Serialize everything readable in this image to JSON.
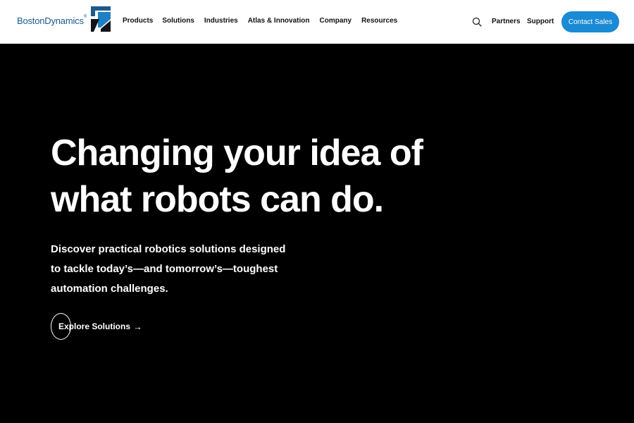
{
  "header": {
    "logo_text": "BostonDynamics",
    "logo_reg": "®",
    "nav": [
      {
        "label": "Products"
      },
      {
        "label": "Solutions"
      },
      {
        "label": "Industries"
      },
      {
        "label": "Atlas & Innovation"
      },
      {
        "label": "Company"
      },
      {
        "label": "Resources"
      }
    ],
    "search_icon": "search-icon",
    "partners_label": "Partners",
    "support_label": "Support",
    "contact_label": "Contact Sales",
    "accent_color": "#1a8ad4",
    "brand_color": "#1d5a8e"
  },
  "hero": {
    "title": "Changing your idea of what robots can do.",
    "subtitle": "Discover practical robotics solutions designed to tackle today’s—and tomorrow’s—toughest automation challenges.",
    "cta_label": "Explore Solutions",
    "cta_arrow": "→",
    "background": "#000000"
  }
}
